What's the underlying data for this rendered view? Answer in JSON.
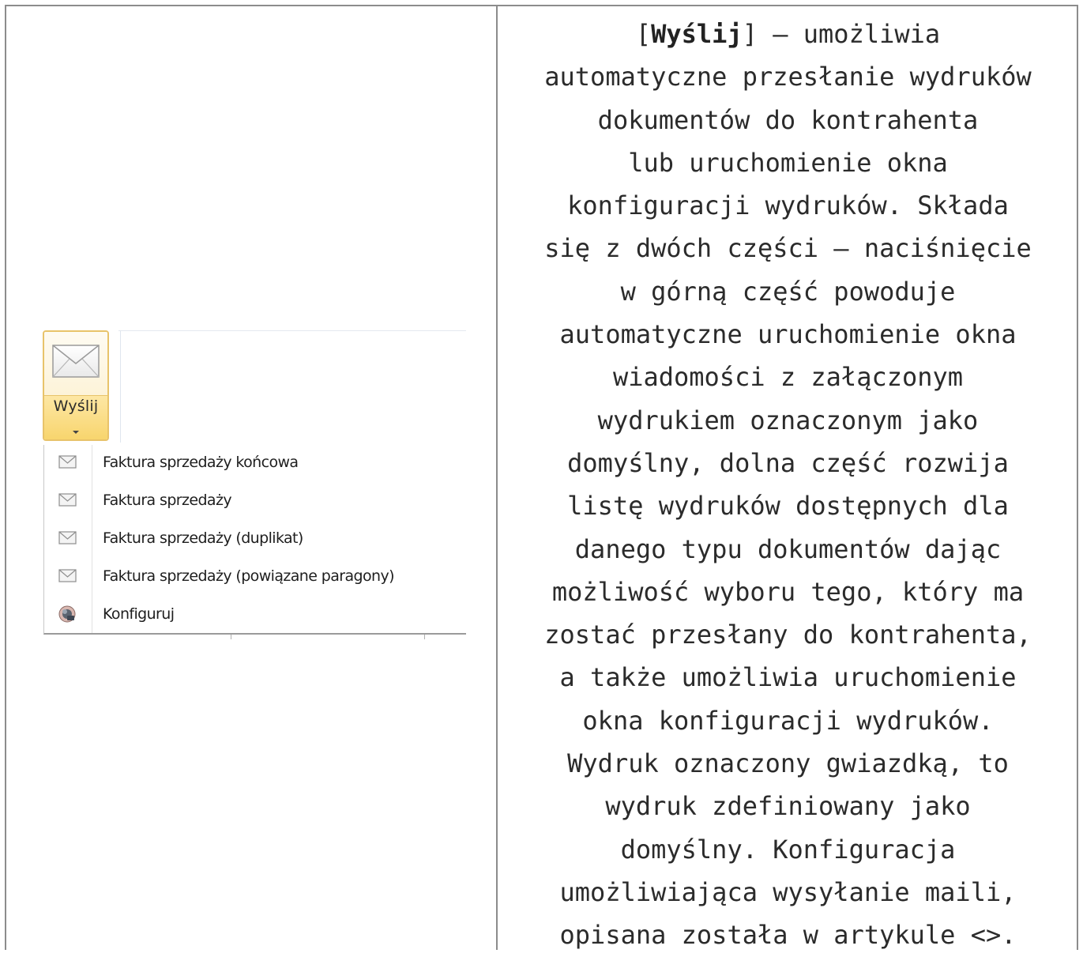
{
  "ui": {
    "split_button": {
      "label": "Wyślij",
      "icon": "envelope-icon"
    },
    "menu_items": [
      {
        "label": "Faktura sprzedaży końcowa",
        "icon": "envelope-icon"
      },
      {
        "label": "Faktura sprzedaży",
        "icon": "envelope-icon"
      },
      {
        "label": "Faktura sprzedaży (duplikat)",
        "icon": "envelope-icon"
      },
      {
        "label": "Faktura sprzedaży (powiązane paragony)",
        "icon": "envelope-icon"
      },
      {
        "label": "Konfiguruj",
        "icon": "config-icon"
      }
    ]
  },
  "description": {
    "open_bracket": "[",
    "button_name": "Wyślij",
    "line_1_rest": "] – umożliwia",
    "lines": [
      "automatyczne przesłanie wydruków",
      "dokumentów do kontrahenta",
      "lub uruchomienie okna",
      "konfiguracji wydruków. Składa",
      "się z dwóch części – naciśnięcie",
      "w górną część powoduje",
      "automatyczne uruchomienie okna",
      "wiadomości z załączonym",
      "wydrukiem oznaczonym jako",
      "domyślny, dolna część rozwija",
      "listę wydruków dostępnych dla",
      "danego typu dokumentów dając",
      "możliwość wyboru tego, który ma",
      "zostać przesłany do kontrahenta,",
      "a także umożliwia uruchomienie",
      "okna konfiguracji wydruków.",
      "Wydruk oznaczony gwiazdką, to",
      "wydruk zdefiniowany jako",
      "domyślny. Konfiguracja",
      "umożliwiająca wysyłanie maili,",
      "opisana została w artykule <>."
    ]
  },
  "colors": {
    "border": "#8c8c8c",
    "button_highlight": "#f8d56e",
    "button_border": "#e8c36a",
    "text": "#2b2b2b"
  }
}
